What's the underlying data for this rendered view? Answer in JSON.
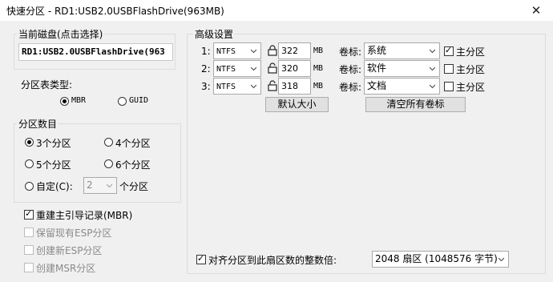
{
  "window": {
    "title": "快速分区 - RD1:USB2.0USBFlashDrive(963MB)",
    "close_glyph": "✕"
  },
  "disk": {
    "label": "当前磁盘(点击选择)",
    "value": "RD1:USB2.0USBFlashDrive(963"
  },
  "table_type": {
    "label": "分区表类型:",
    "options": [
      "MBR",
      "GUID"
    ],
    "selected": "MBR"
  },
  "partition_count": {
    "label": "分区数目",
    "options": [
      "3个分区",
      "4个分区",
      "5个分区",
      "6个分区"
    ],
    "selected": "3个分区",
    "custom_label": "自定(C):",
    "custom_value": "2",
    "custom_suffix": "个分区"
  },
  "options": {
    "rebuild_mbr": {
      "label": "重建主引导记录(MBR)",
      "checked": true
    },
    "keep_esp": {
      "label": "保留现有ESP分区",
      "checked": false
    },
    "create_esp": {
      "label": "创建新ESP分区",
      "checked": false
    },
    "create_msr": {
      "label": "创建MSR分区",
      "checked": false
    }
  },
  "advanced": {
    "label": "高级设置",
    "unit": "MB",
    "volume_label_text": "卷标:",
    "primary_text": "主分区",
    "rows": [
      {
        "index": "1:",
        "fs": "NTFS",
        "size": "322",
        "locked": true,
        "volume": "系统",
        "primary": true
      },
      {
        "index": "2:",
        "fs": "NTFS",
        "size": "320",
        "locked": false,
        "volume": "软件",
        "primary": false
      },
      {
        "index": "3:",
        "fs": "NTFS",
        "size": "318",
        "locked": false,
        "volume": "文档",
        "primary": false
      }
    ],
    "default_size_button": "默认大小",
    "clear_labels_button": "清空所有卷标",
    "align": {
      "label": "对齐分区到此扇区数的整数倍:",
      "checked": true,
      "value": "2048 扇区 (1048576 字节)"
    }
  }
}
